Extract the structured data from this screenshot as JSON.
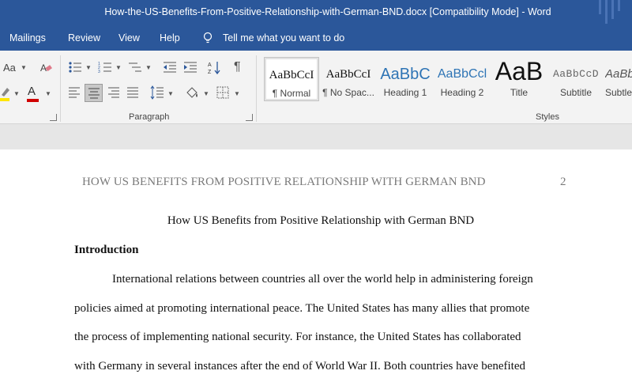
{
  "window": {
    "title": "How-the-US-Benefits-From-Positive-Relationship-with-German-BND.docx [Compatibility Mode]  -  Word"
  },
  "menu": {
    "items": [
      "Mailings",
      "Review",
      "View",
      "Help"
    ],
    "tell_me": "Tell me what you want to do"
  },
  "ribbon": {
    "font_group": {
      "grow_shrink": "Aa",
      "font_color_letter": "A"
    },
    "paragraph_label": "Paragraph",
    "styles_label": "Styles",
    "styles": [
      {
        "sample": "AaBbCcI",
        "name": "¶ Normal"
      },
      {
        "sample": "AaBbCcI",
        "name": "¶ No Spac..."
      },
      {
        "sample": "AaBbC",
        "name": "Heading 1"
      },
      {
        "sample": "AaBbCcl",
        "name": "Heading 2"
      },
      {
        "sample": "AaB",
        "name": "Title"
      },
      {
        "sample": "AaBbCcD",
        "name": "Subtitle"
      },
      {
        "sample": "AaBb",
        "name": "Subtle"
      }
    ],
    "colors": {
      "highlight": "#ffe600",
      "font_color": "#d00000",
      "accent": "#2b579a"
    }
  },
  "document": {
    "running_head": "HOW US BENEFITS FROM POSITIVE RELATIONSHIP WITH GERMAN BND",
    "page_number": "2",
    "title": "How US Benefits from Positive Relationship with German BND",
    "heading": "Introduction",
    "lines": [
      "International relations between countries all over the world help in administering foreign",
      "policies aimed at promoting international peace. The United States has many allies that promote",
      "the process of implementing national security. For instance, the United States has collaborated",
      "with Germany in several instances after the end of World War II. Both countries have benefited"
    ]
  }
}
